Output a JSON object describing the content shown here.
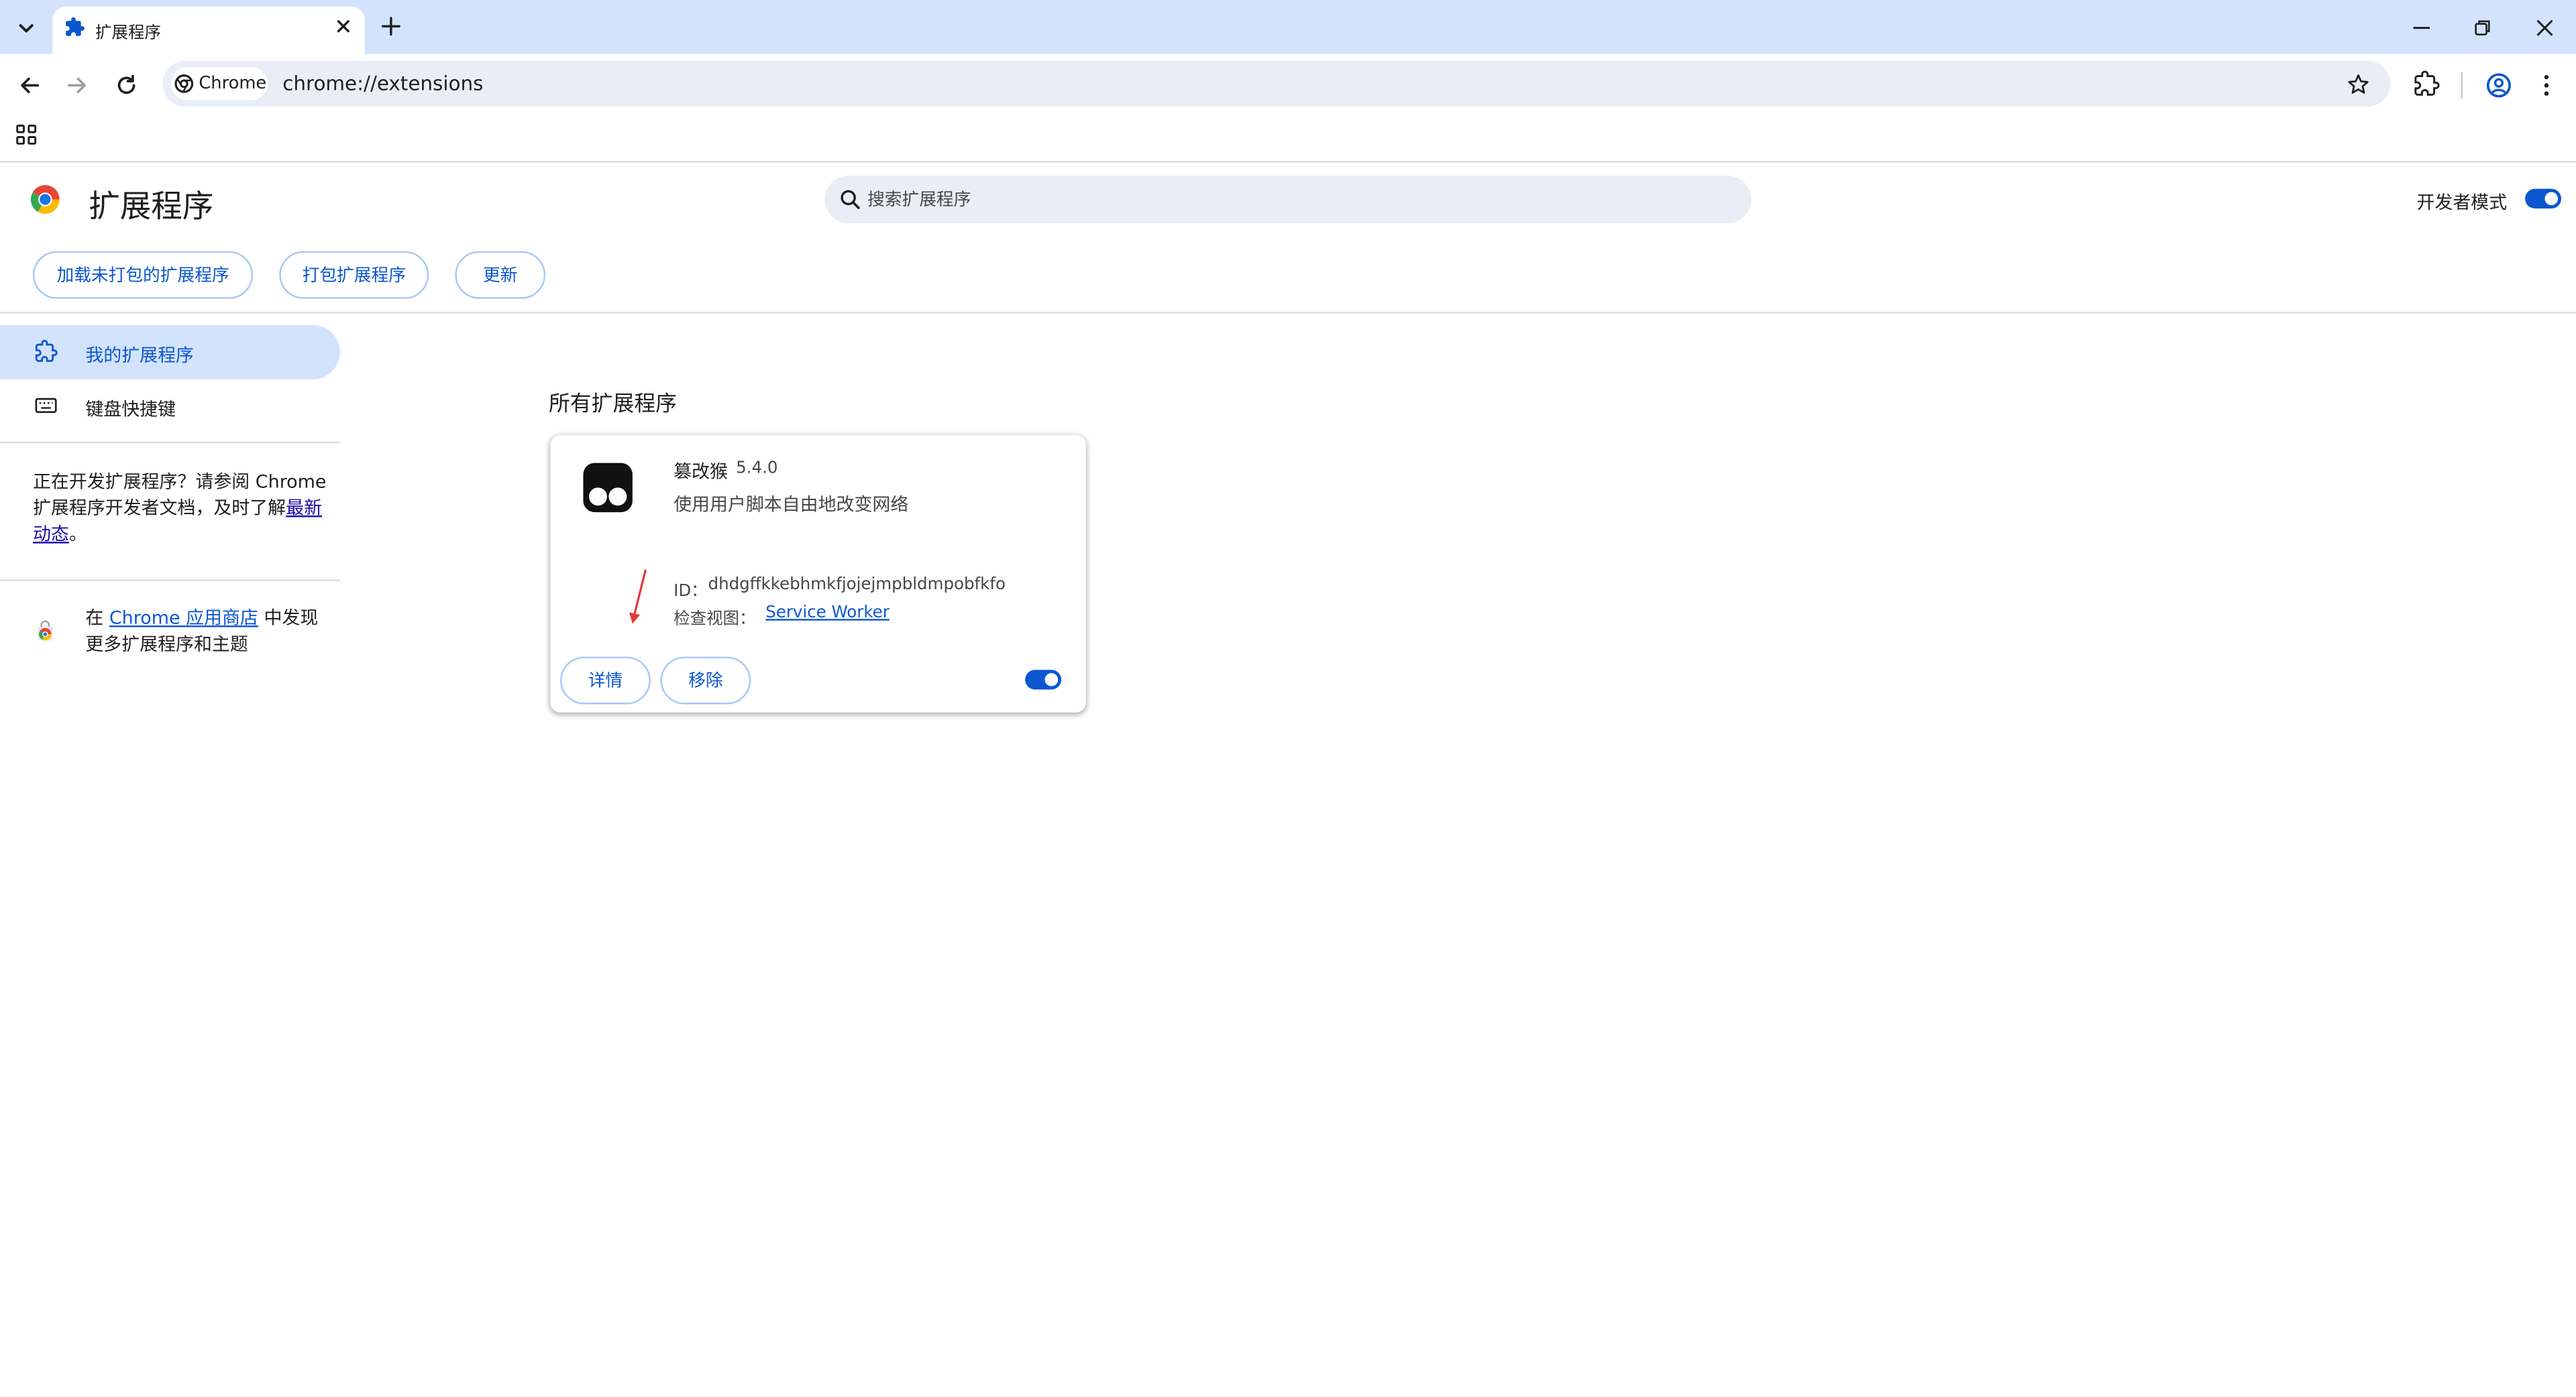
{
  "browser": {
    "tab_title": "扩展程序",
    "site_chip": "Chrome",
    "url": "chrome://extensions"
  },
  "page": {
    "title": "扩展程序",
    "search_placeholder": "搜索扩展程序",
    "dev_mode_label": "开发者模式",
    "dev_mode_on": true,
    "actions": {
      "load_unpacked": "加载未打包的扩展程序",
      "pack": "打包扩展程序",
      "update": "更新"
    }
  },
  "sidebar": {
    "items": [
      {
        "label": "我的扩展程序",
        "icon": "extension-icon",
        "selected": true
      },
      {
        "label": "键盘快捷键",
        "icon": "keyboard-icon",
        "selected": false
      }
    ],
    "dev_note": {
      "text": "正在开发扩展程序？请参阅 Chrome 扩展程序开发者文档，及时了解",
      "link": "最新动态",
      "suffix": "。"
    },
    "store_note": {
      "prefix": "在 ",
      "link": "Chrome 应用商店",
      "suffix": " 中发现更多扩展程序和主题"
    }
  },
  "main": {
    "section_heading": "所有扩展程序",
    "extension": {
      "name": "篡改猴",
      "version": "5.4.0",
      "description": "使用用户脚本自由地改变网络",
      "id_label": "ID：",
      "id": "dhdgffkkebhmkfjojejmpbldmpobfkfo",
      "inspect_label": "检查视图：",
      "inspect_link": "Service Worker",
      "details_label": "详情",
      "remove_label": "移除",
      "enabled": true
    }
  },
  "colors": {
    "accent": "#0b57d0",
    "tabstrip": "#d3e3fd",
    "omnibox": "#e9eef6",
    "annotation_arrow": "#e53935"
  }
}
